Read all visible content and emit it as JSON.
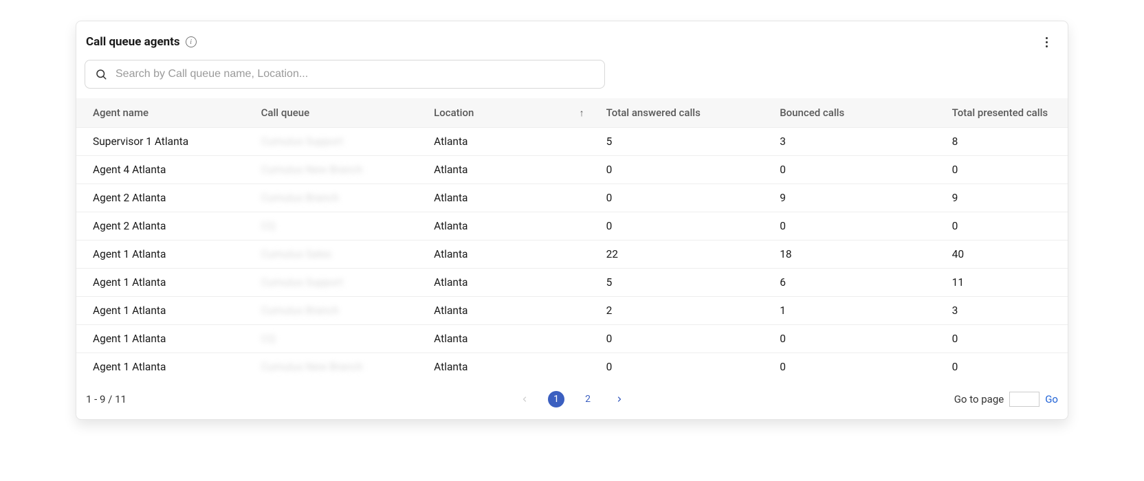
{
  "header": {
    "title": "Call queue agents"
  },
  "search": {
    "placeholder": "Search by Call queue name, Location..."
  },
  "columns": {
    "agent": "Agent name",
    "queue": "Call queue",
    "location": "Location",
    "answered": "Total answered calls",
    "bounced": "Bounced calls",
    "presented": "Total presented calls"
  },
  "sort": {
    "column": "location",
    "direction": "asc",
    "arrow": "↑"
  },
  "rows": [
    {
      "agent": "Supervisor 1 Atlanta",
      "queue": "Cumulus Support",
      "location": "Atlanta",
      "answered": "5",
      "bounced": "3",
      "presented": "8"
    },
    {
      "agent": "Agent 4 Atlanta",
      "queue": "Cumulus New Branch",
      "location": "Atlanta",
      "answered": "0",
      "bounced": "0",
      "presented": "0"
    },
    {
      "agent": "Agent 2 Atlanta",
      "queue": "Cumulus Branch",
      "location": "Atlanta",
      "answered": "0",
      "bounced": "9",
      "presented": "9"
    },
    {
      "agent": "Agent 2 Atlanta",
      "queue": "CQ",
      "location": "Atlanta",
      "answered": "0",
      "bounced": "0",
      "presented": "0"
    },
    {
      "agent": "Agent 1 Atlanta",
      "queue": "Cumulus Sales",
      "location": "Atlanta",
      "answered": "22",
      "bounced": "18",
      "presented": "40"
    },
    {
      "agent": "Agent 1 Atlanta",
      "queue": "Cumulus Support",
      "location": "Atlanta",
      "answered": "5",
      "bounced": "6",
      "presented": "11"
    },
    {
      "agent": "Agent 1 Atlanta",
      "queue": "Cumulus Branch",
      "location": "Atlanta",
      "answered": "2",
      "bounced": "1",
      "presented": "3"
    },
    {
      "agent": "Agent 1 Atlanta",
      "queue": "CQ",
      "location": "Atlanta",
      "answered": "0",
      "bounced": "0",
      "presented": "0"
    },
    {
      "agent": "Agent 1 Atlanta",
      "queue": "Cumulus New Branch",
      "location": "Atlanta",
      "answered": "0",
      "bounced": "0",
      "presented": "0"
    }
  ],
  "pagination": {
    "range": "1 - 9 / 11",
    "pages": [
      "1",
      "2"
    ],
    "current": "1",
    "goto_label": "Go to page",
    "go_label": "Go"
  }
}
